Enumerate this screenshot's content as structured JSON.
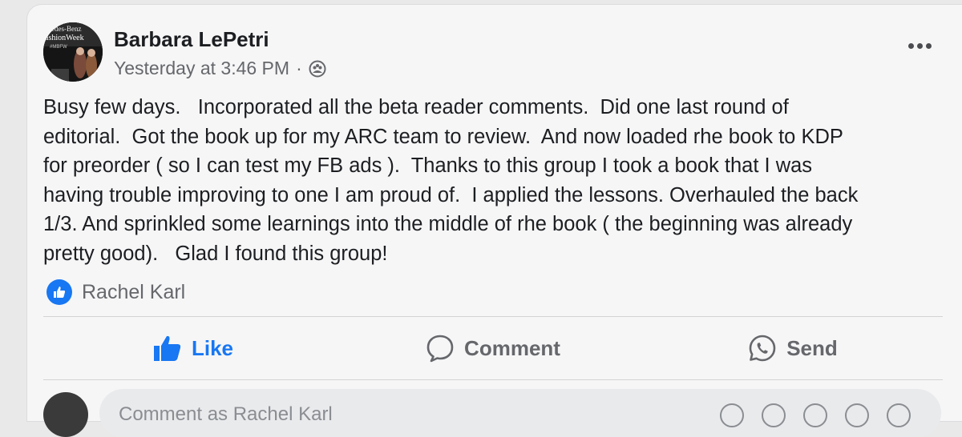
{
  "post": {
    "author": "Barbara LePetri",
    "timestamp": "Yesterday at 3:46 PM",
    "separator": "·",
    "privacy_icon": "group-icon",
    "more_icon": "more-options-icon",
    "text": "Busy few days.   Incorporated all the beta reader comments.  Did one last round of\neditorial.  Got the book up for my ARC team to review.  And now loaded rhe book to KDP\nfor preorder ( so I can test my FB ads ).  Thanks to this group I took a book that I was\nhaving trouble improving to one I am proud of.  I applied the lessons. Overhauled the back\n1/3. And sprinkled some learnings into the middle of rhe book ( the beginning was already\npretty good).   Glad I found this group!"
  },
  "avatar_text": {
    "line1": "edes-Benz",
    "line2": "ashionWeek",
    "line3": "#MBFW"
  },
  "reactions": {
    "names": "Rachel Karl",
    "icon": "like-reaction-icon"
  },
  "actions": {
    "like": "Like",
    "comment": "Comment",
    "send": "Send"
  },
  "comment_box": {
    "placeholder": "Comment as Rachel Karl"
  },
  "colors": {
    "accent": "#1877f2",
    "secondary_text": "#65676b",
    "card_bg": "#f6f6f7"
  }
}
